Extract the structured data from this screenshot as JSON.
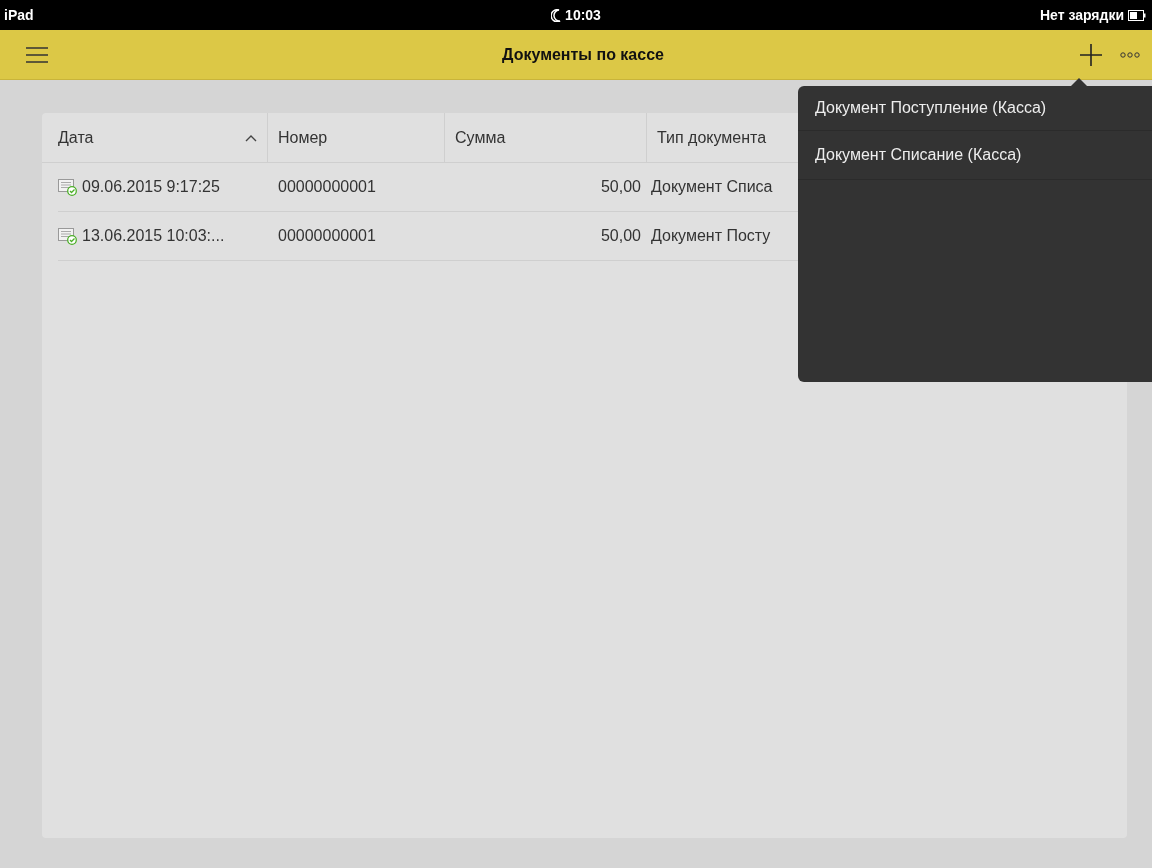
{
  "status_bar": {
    "device": "iPad",
    "time": "10:03",
    "charging": "Нет зарядки"
  },
  "header": {
    "title": "Документы по кассе"
  },
  "table": {
    "columns": [
      {
        "label": "Дата",
        "sorted": true
      },
      {
        "label": "Номер",
        "sorted": false
      },
      {
        "label": "Сумма",
        "sorted": false
      },
      {
        "label": "Тип документа",
        "sorted": false
      }
    ],
    "rows": [
      {
        "posted": true,
        "date": "09.06.2015 9:17:25",
        "number": "00000000001",
        "sum": "50,00",
        "type": "Документ Списа"
      },
      {
        "posted": true,
        "date": "13.06.2015 10:03:...",
        "number": "00000000001",
        "sum": "50,00",
        "type": "Документ Посту"
      }
    ]
  },
  "add_menu": {
    "items": [
      "Документ Поступление (Касса)",
      "Документ Списание (Касса)"
    ]
  }
}
